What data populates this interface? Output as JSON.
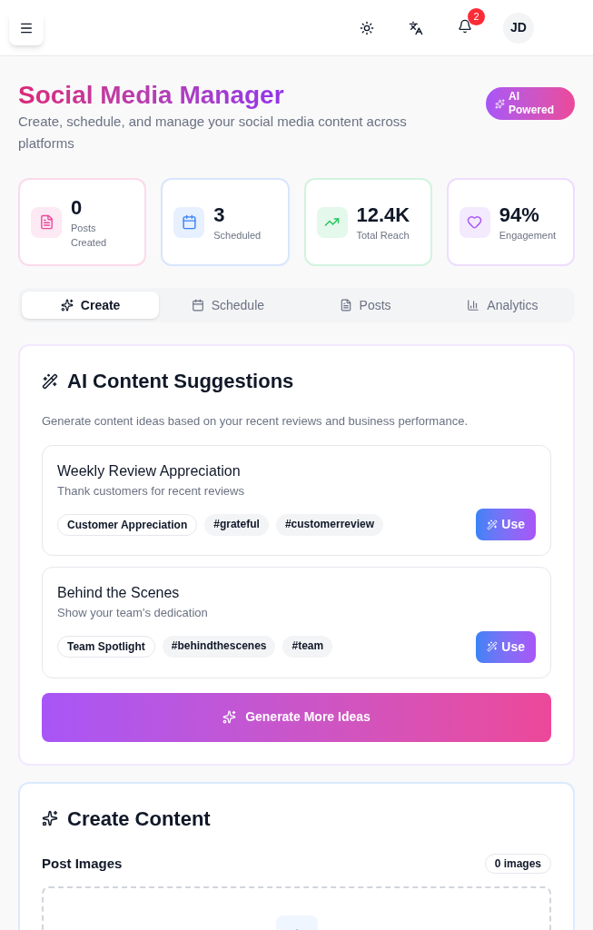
{
  "header": {
    "notification_count": "2",
    "avatar": "JD"
  },
  "title": "Social Media Manager",
  "subtitle": "Create, schedule, and manage your social media content across platforms",
  "badge": "AI Powered",
  "stats": [
    {
      "value": "0",
      "label": "Posts Created",
      "color": "#ec4899"
    },
    {
      "value": "3",
      "label": "Scheduled",
      "color": "#3b82f6"
    },
    {
      "value": "12.4K",
      "label": "Total Reach",
      "color": "#22c55e"
    },
    {
      "value": "94%",
      "label": "Engagement",
      "color": "#a855f7"
    }
  ],
  "tabs": [
    {
      "label": "Create",
      "selected": true
    },
    {
      "label": "Schedule",
      "selected": false
    },
    {
      "label": "Posts",
      "selected": false
    },
    {
      "label": "Analytics",
      "selected": false
    }
  ],
  "suggestions": {
    "title": "AI Content Suggestions",
    "description": "Generate content ideas based on your recent reviews and business performance.",
    "items": [
      {
        "title": "Weekly Review Appreciation",
        "subtitle": "Thank customers for recent reviews",
        "tags": [
          {
            "text": "Customer Appreciation",
            "kind": "category"
          },
          {
            "text": "#grateful",
            "kind": "hashtag"
          },
          {
            "text": "#customerreview",
            "kind": "hashtag"
          }
        ],
        "button": "Use"
      },
      {
        "title": "Behind the Scenes",
        "subtitle": "Show your team's dedication",
        "tags": [
          {
            "text": "Team Spotlight",
            "kind": "category"
          },
          {
            "text": "#behindthescenes",
            "kind": "hashtag"
          },
          {
            "text": "#team",
            "kind": "hashtag"
          }
        ],
        "button": "Use"
      }
    ],
    "generate_button": "Generate More Ideas"
  },
  "create_content": {
    "title": "Create Content",
    "images_label": "Post Images",
    "images_count": "0 images"
  }
}
